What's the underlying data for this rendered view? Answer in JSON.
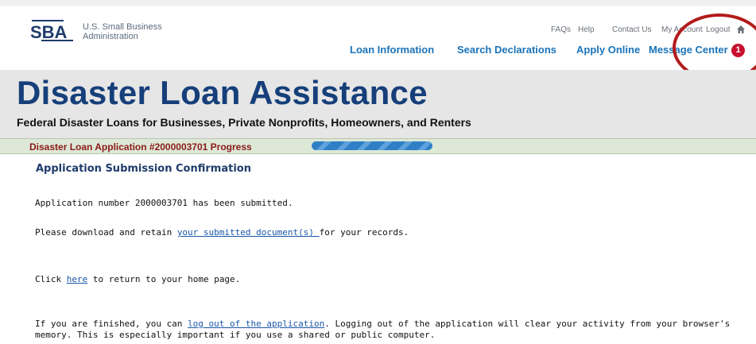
{
  "header": {
    "logo_letters": "SBA",
    "logo_text": "U.S. Small Business Administration",
    "utility_links": [
      "FAQs",
      "Help",
      "Contact Us",
      "My Account",
      "Logout"
    ],
    "nav_links": [
      "Loan Information",
      "Search Declarations",
      "Apply Online",
      "Message Center"
    ],
    "message_badge_count": "1"
  },
  "banner": {
    "title": "Disaster Loan Assistance",
    "subtitle": "Federal Disaster Loans for Businesses, Private Nonprofits, Homeowners, and Renters"
  },
  "progress": {
    "label": "Disaster Loan Application #2000003701 Progress",
    "value": 1.0
  },
  "main": {
    "title": "Application Submission Confirmation",
    "p1": "Application number 2000003701 has been submitted.",
    "p2_pre": "Please download and retain ",
    "p2_link": "your submitted document(s) ",
    "p2_post": "for your records.",
    "p3_pre": "Click ",
    "p3_link": "here",
    "p3_post": " to return to your home page.",
    "p4_pre": "If you are finished, you can ",
    "p4_link": "log out of the application",
    "p4_post": ". Logging out of the application will clear your activity from your browser's",
    "p4_line2": "memory. This is especially important if you use a shared or public computer."
  },
  "colors": {
    "brand_blue": "#163f7a",
    "nav_blue": "#1a73b8",
    "badge_red": "#c8102e",
    "progress_label": "#8b1a1a"
  },
  "icons": [
    "sba-logo-icon",
    "home-icon"
  ]
}
